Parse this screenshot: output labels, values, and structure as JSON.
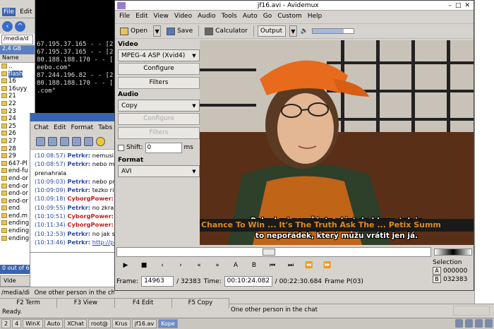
{
  "file_manager": {
    "menu": [
      "File",
      "Edit"
    ],
    "path": "/media/d",
    "disk": "2,4 GB",
    "column": "Name",
    "items": [
      "..",
      "flash",
      "16",
      "16uyy",
      "21",
      "22",
      "23",
      "24",
      "25",
      "26",
      "27",
      "28",
      "29",
      "647-Pl",
      "end-fu",
      "end-or",
      "end-or",
      "end-or",
      "end-or",
      "end",
      "end.m",
      "ending",
      "ending",
      "ending"
    ],
    "selected_index": 1,
    "count": "0 out of 6",
    "tab": "Vide"
  },
  "terminal": {
    "lines": [
      "67.195.37.165 - - [2",
      "67.195.37.165 - - [2",
      "80.188.188.170 - - [",
      "eebo.com\"",
      "87.244.196.82 - - [2",
      "80.188.188.170 - - [",
      ".com\""
    ]
  },
  "chat": {
    "menu": [
      "Chat",
      "Edit",
      "Format",
      "Tabs"
    ],
    "messages": [
      {
        "time": "(10:08:57)",
        "nick": "Petrkr:",
        "text": "nemusi",
        "red": false
      },
      {
        "time": "(10:08:57)",
        "nick": "Petrkr:",
        "text": "nebo mu",
        "red": false
      },
      {
        "time": "",
        "nick": "",
        "text": "prenahrala",
        "red": false
      },
      {
        "time": "(10:09:03)",
        "nick": "Petrkr:",
        "text": "nebo pre",
        "red": false
      },
      {
        "time": "(10:09:09)",
        "nick": "Petrkr:",
        "text": "tezko ric",
        "red": false
      },
      {
        "time": "(10:09:18)",
        "nick": "CyborgPower:",
        "text": "",
        "red": true
      },
      {
        "time": "(10:09:55)",
        "nick": "Petrkr:",
        "text": "no zkrab",
        "red": false
      },
      {
        "time": "(10:10:51)",
        "nick": "CyborgPower:",
        "text": "",
        "red": true
      },
      {
        "time": "(10:11:34)",
        "nick": "CyborgPower:",
        "text": "",
        "red": true
      },
      {
        "time": "(10:12:53)",
        "nick": "Petrkr:",
        "text": "no jak se",
        "red": false
      },
      {
        "time": "(10:13:46)",
        "nick": "Petrkr:",
        "text": "http://pe",
        "red": false,
        "link": true
      }
    ]
  },
  "left_status": "/media/di",
  "chat_status": "One other person in the chat",
  "fkeys": [
    "F2 Term",
    "F3 View",
    "F4 Edit",
    "F5 Copy"
  ],
  "ready": "Ready.",
  "avidemux": {
    "title": "jf16.avi - Avidemux",
    "window_buttons": [
      "–",
      "□",
      "✕"
    ],
    "menu": [
      "File",
      "Edit",
      "View",
      "Video",
      "Audio",
      "Tools",
      "Auto",
      "Go",
      "Custom",
      "Help"
    ],
    "toolbar": {
      "open": "Open",
      "save": "Save",
      "calculator": "Calculator",
      "output": "Output"
    },
    "volume_level": 0.75,
    "video_label": "Video",
    "video_codec": "MPEG-4 ASP (Xvid4)",
    "configure": "Configure",
    "filters": "Filters",
    "audio_label": "Audio",
    "audio_codec": "Copy",
    "shift_label": "Shift:",
    "shift_value": "0",
    "shift_unit": "ms",
    "format_label": "Format",
    "format_value": "AVI",
    "subtitle_line1": "Pokud mi nemůžete vlézt do hlavy, tak je",
    "subtitle_line2": "to nepořádek, který můžu vrátit jen já.",
    "ticker_text": "Chance To Win ... It's The Truth Ask The ... Petix Summ",
    "seek_position": 0.465,
    "controls": [
      "▶",
      "■",
      "‹",
      "›",
      "«",
      "»",
      "A",
      "B",
      "⏮",
      "⏭",
      "⏪",
      "⏩"
    ],
    "selection_label": "Selection",
    "sel_a_label": "A",
    "sel_a_value": "000000",
    "sel_b_label": "B",
    "sel_b_value": "032383",
    "frame_label": "Frame:",
    "frame_value": "14963",
    "frame_total": "/ 32383",
    "time_label": "Time:",
    "time_value": "00:10:24.082",
    "time_total": "/ 00:22:30.684",
    "frame_type": "Frame P(03)"
  },
  "status2": "One other person in the chat",
  "taskbar": {
    "items": [
      "2",
      "4",
      "WinX",
      "Auto",
      "XChat",
      "root@",
      "Krus",
      "jf16.av",
      "Kope"
    ],
    "active_index": 8
  }
}
